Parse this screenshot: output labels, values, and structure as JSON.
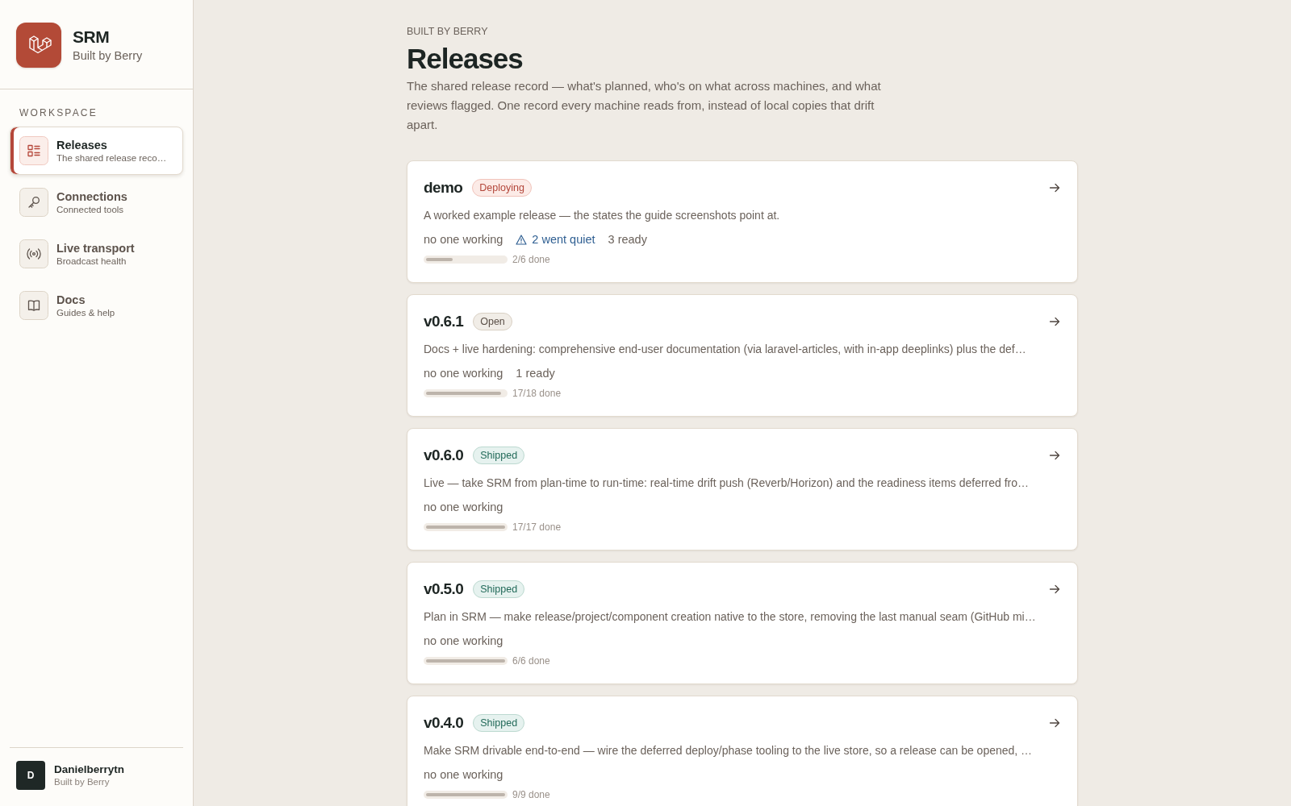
{
  "sidebar": {
    "brand": {
      "title": "SRM",
      "subtitle": "Built by Berry"
    },
    "section_label": "WORKSPACE",
    "items": [
      {
        "label": "Releases",
        "sublabel": "The shared release reco…",
        "selected": true
      },
      {
        "label": "Connections",
        "sublabel": "Connected tools",
        "selected": false
      },
      {
        "label": "Live transport",
        "sublabel": "Broadcast health",
        "selected": false
      },
      {
        "label": "Docs",
        "sublabel": "Guides & help",
        "selected": false
      }
    ],
    "user": {
      "initial": "D",
      "name": "Danielberrytn",
      "subtitle": "Built by Berry"
    }
  },
  "header": {
    "eyebrow": "BUILT BY BERRY",
    "title": "Releases",
    "description": "The shared release record — what's planned, who's on what across machines, and what reviews flagged. One record every machine reads from, instead of local copies that drift apart."
  },
  "releases": [
    {
      "name": "demo",
      "status": {
        "label": "Deploying",
        "kind": "deploying"
      },
      "description": "A worked example release — the states the guide screenshots point at.",
      "meta": [
        {
          "kind": "plain",
          "text": "no one working"
        },
        {
          "kind": "warning",
          "text": "2 went quiet"
        },
        {
          "kind": "plain",
          "text": "3 ready"
        }
      ],
      "progress": {
        "level": 0.333,
        "label": "2/6 done"
      }
    },
    {
      "name": "v0.6.1",
      "status": {
        "label": "Open",
        "kind": "open"
      },
      "description": "Docs + live hardening: comprehensive end-user documentation (via laravel-articles, with in-app deeplinks) plus the def…",
      "meta": [
        {
          "kind": "plain",
          "text": "no one working"
        },
        {
          "kind": "plain",
          "text": "1 ready"
        }
      ],
      "progress": {
        "level": 0.944,
        "label": "17/18 done"
      }
    },
    {
      "name": "v0.6.0",
      "status": {
        "label": "Shipped",
        "kind": "shipped"
      },
      "description": "Live — take SRM from plan-time to run-time: real-time drift push (Reverb/Horizon) and the readiness items deferred fro…",
      "meta": [
        {
          "kind": "plain",
          "text": "no one working"
        }
      ],
      "progress": {
        "level": 1,
        "label": "17/17 done"
      }
    },
    {
      "name": "v0.5.0",
      "status": {
        "label": "Shipped",
        "kind": "shipped"
      },
      "description": "Plan in SRM — make release/project/component creation native to the store, removing the last manual seam (GitHub mi…",
      "meta": [
        {
          "kind": "plain",
          "text": "no one working"
        }
      ],
      "progress": {
        "level": 1,
        "label": "6/6 done"
      }
    },
    {
      "name": "v0.4.0",
      "status": {
        "label": "Shipped",
        "kind": "shipped"
      },
      "description": "Make SRM drivable end-to-end — wire the deferred deploy/phase tooling to the live store, so a release can be opened, …",
      "meta": [
        {
          "kind": "plain",
          "text": "no one working"
        }
      ],
      "progress": {
        "level": 1,
        "label": "9/9 done"
      }
    }
  ]
}
